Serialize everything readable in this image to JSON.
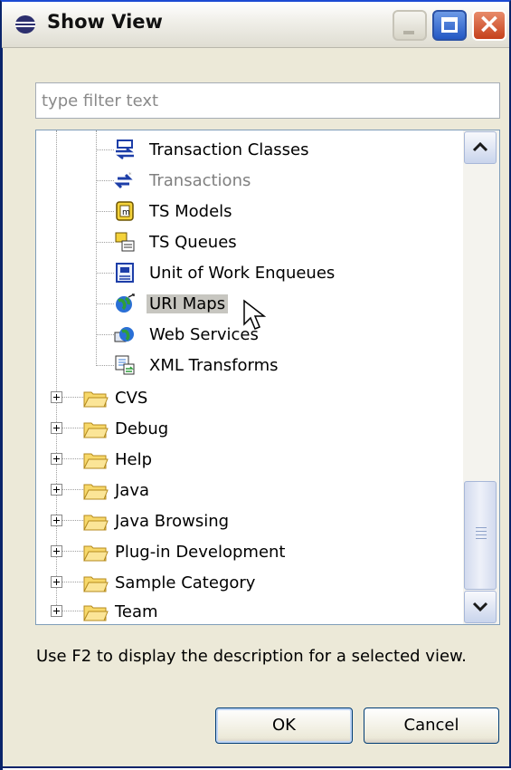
{
  "window": {
    "title": "Show View",
    "icon": "eclipse-icon",
    "controls": [
      "minimize-icon",
      "maximize-icon",
      "close-icon"
    ]
  },
  "filter": {
    "placeholder": "type filter text",
    "value": ""
  },
  "tree": {
    "children": [
      {
        "label": "Transaction Classes",
        "icon": "transaction-classes-icon"
      },
      {
        "label": "Transactions",
        "icon": "transactions-icon",
        "dimmed": true
      },
      {
        "label": "TS Models",
        "icon": "ts-models-icon"
      },
      {
        "label": "TS Queues",
        "icon": "ts-queues-icon"
      },
      {
        "label": "Unit of Work Enqueues",
        "icon": "unit-of-work-icon"
      },
      {
        "label": "URI Maps",
        "icon": "globe-icon",
        "selected": true
      },
      {
        "label": "Web Services",
        "icon": "web-services-icon"
      },
      {
        "label": "XML Transforms",
        "icon": "xml-transforms-icon"
      }
    ],
    "categories": [
      {
        "label": "CVS"
      },
      {
        "label": "Debug"
      },
      {
        "label": "Help"
      },
      {
        "label": "Java"
      },
      {
        "label": "Java Browsing"
      },
      {
        "label": "Plug-in Development"
      },
      {
        "label": "Sample Category"
      },
      {
        "label": "Team"
      }
    ]
  },
  "hint": "Use F2 to display the description for a selected view.",
  "buttons": {
    "ok": "OK",
    "cancel": "Cancel"
  },
  "colors": {
    "selection": "#c7c6c0",
    "title_close": "#c5401c",
    "folder": "#f2c94c"
  }
}
